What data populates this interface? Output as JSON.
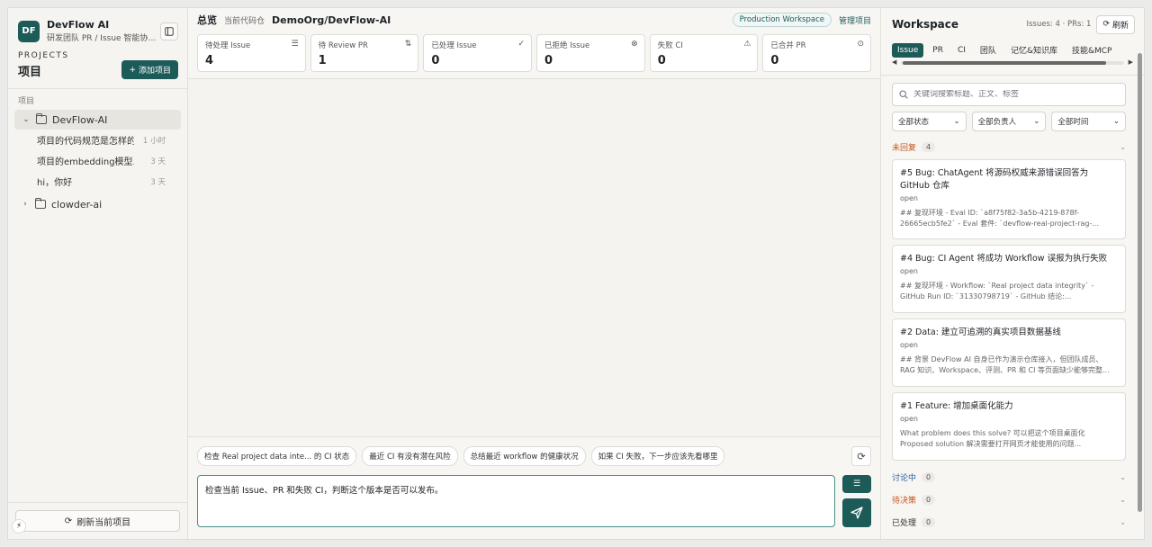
{
  "brand": {
    "logo_text": "DF",
    "name": "DevFlow AI",
    "subtitle": "研发团队 PR / Issue 智能协作 ..."
  },
  "projects": {
    "eyebrow": "PROJECTS",
    "title": "项目",
    "add_label": "添加项目",
    "section_label": "项目",
    "items": [
      {
        "name": "DevFlow-AI",
        "expanded": true,
        "sessions": [
          {
            "title": "项目的代码规范是怎样的",
            "time": "1 小时"
          },
          {
            "title": "项目的embedding模型...",
            "time": "3 天"
          },
          {
            "title": "hi，你好",
            "time": "3 天"
          }
        ]
      },
      {
        "name": "clowder-ai",
        "expanded": false
      }
    ],
    "refresh_label": "刷新当前项目"
  },
  "header": {
    "title": "总览",
    "repo_label": "当前代码仓",
    "repo": "DemoOrg/DevFlow-AI",
    "workspace_badge": "Production Workspace",
    "manage_link": "管理项目"
  },
  "stats": [
    {
      "label": "待处理 Issue",
      "value": "4",
      "icon": "list-check-icon"
    },
    {
      "label": "待 Review PR",
      "value": "1",
      "icon": "pull-request-icon"
    },
    {
      "label": "已处理 Issue",
      "value": "0",
      "icon": "check-circle-icon"
    },
    {
      "label": "已拒绝 Issue",
      "value": "0",
      "icon": "x-circle-icon"
    },
    {
      "label": "失败 CI",
      "value": "0",
      "icon": "warning-icon"
    },
    {
      "label": "已合并 PR",
      "value": "0",
      "icon": "merged-circle-icon"
    }
  ],
  "composer": {
    "suggestions": [
      "检查 Real project data inte... 的 CI 状态",
      "最近 CI 有没有潜在风险",
      "总结最近 workflow 的健康状况",
      "如果 CI 失败，下一步应该先看哪里"
    ],
    "input_value": "检查当前 Issue、PR 和失败 CI，判断这个版本是否可以发布。"
  },
  "workspace": {
    "title": "Workspace",
    "counts": "Issues: 4 · PRs: 1",
    "refresh_label": "刷新",
    "tabs": [
      "Issue",
      "PR",
      "CI",
      "团队",
      "记忆&知识库",
      "技能&MCP"
    ],
    "active_tab": "Issue",
    "search_placeholder": "关键词搜索标题、正文、标签",
    "filters": [
      "全部状态",
      "全部负责人",
      "全部时间"
    ],
    "groups": [
      {
        "name": "未回复",
        "count": "4",
        "issues": [
          {
            "title": "#5 Bug: ChatAgent 将源码权威来源错误回答为 GitHub 仓库",
            "state": "open",
            "body": "## 复现环境 - Eval ID: `a8f75f82-3a5b-4219-878f-26665ecb5fe2` - Eval 套件: `devflow-real-project-rag-..."
          },
          {
            "title": "#4 Bug: CI Agent 将成功 Workflow 误报为执行失败",
            "state": "open",
            "body": "## 复现环境 - Workflow: `Real project data integrity` - GitHub Run ID: `31330798719` - GitHub 结论:..."
          },
          {
            "title": "#2 Data: 建立可追溯的真实项目数据基线",
            "state": "open",
            "body": "## 背景 DevFlow AI 自身已作为演示仓库接入，但团队成员、RAG 知识、Workspace、评测、PR 和 CI 等页面缺少能够完整..."
          },
          {
            "title": "#1 Feature: 增加桌面化能力",
            "state": "open",
            "body": "What problem does this solve? 可以把这个项目桌面化 Proposed solution 解决需要打开网页才能使用的问题..."
          }
        ]
      },
      {
        "name": "讨论中",
        "count": "0"
      },
      {
        "name": "待决策",
        "count": "0"
      },
      {
        "name": "已处理",
        "count": "0"
      }
    ]
  }
}
